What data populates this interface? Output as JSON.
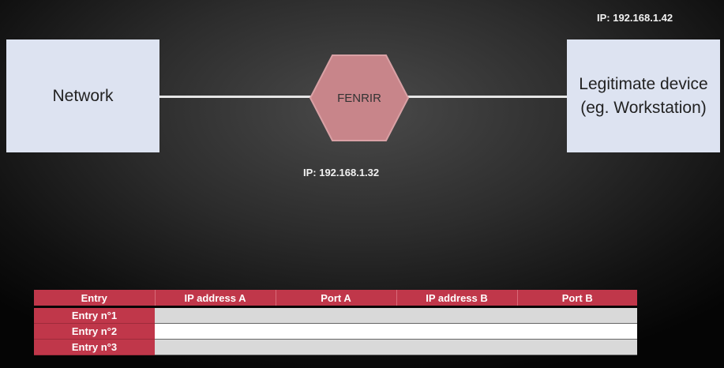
{
  "diagram": {
    "network_label": "Network",
    "device_label_line1": "Legitimate device",
    "device_label_line2": "(eg. Workstation)",
    "fenrir_label": "FENRIR",
    "device_ip": "IP: 192.168.1.42",
    "fenrir_ip": "IP: 192.168.1.32",
    "colors": {
      "box_fill": "#dde3f1",
      "hexagon_fill": "#c8858a",
      "table_header": "#c0374a"
    }
  },
  "table": {
    "headers": [
      "Entry",
      "IP address A",
      "Port A",
      "IP address B",
      "Port B"
    ],
    "rows": [
      {
        "label": "Entry n°1",
        "cells": [
          "",
          "",
          "",
          ""
        ]
      },
      {
        "label": "Entry n°2",
        "cells": [
          "",
          "",
          "",
          ""
        ]
      },
      {
        "label": "Entry n°3",
        "cells": [
          "",
          "",
          "",
          ""
        ]
      }
    ]
  }
}
